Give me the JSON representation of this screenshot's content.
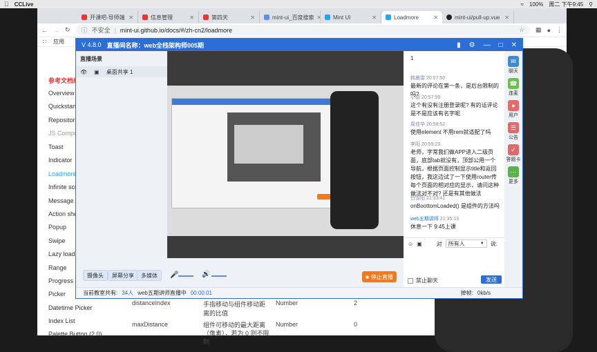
{
  "menubar": {
    "app": "CCLive",
    "battery": "100%",
    "clock": "周二 下午9:45"
  },
  "browser": {
    "tabs": [
      {
        "label": "开课吧-导师端"
      },
      {
        "label": "信息管理"
      },
      {
        "label": "第四天"
      },
      {
        "label": "mint-ui_百度搜索"
      },
      {
        "label": "Mint UI"
      },
      {
        "label": "Loadmore"
      },
      {
        "label": "mint-ui/pull-up.vue"
      }
    ],
    "security": "不安全",
    "url": "mint-ui.github.io/docs/#/zh-cn2/loadmore",
    "bookmarks_label": "应用"
  },
  "sidenav": {
    "heading": "参考文档编",
    "items": [
      "Overview",
      "Quickstart",
      "Repositories",
      "JS Components",
      "Toast",
      "Indicator",
      "Loadmore",
      "Infinite scroll",
      "Message box",
      "Action sheet",
      "Popup",
      "Swipe",
      "Lazy load",
      "Range",
      "Progress",
      "Picker",
      "Datetime Picker",
      "Index List",
      "Palette Button (2.0)"
    ]
  },
  "doc_table": {
    "rows": [
      {
        "name": "distanceIndex",
        "desc": "手指移动与组件移动距离的比值",
        "type": "Number",
        "default": "2"
      },
      {
        "name": "maxDistance",
        "desc": "组件可移动的最大距离（像素），若为 0 则不限制",
        "type": "Number",
        "default": "0"
      }
    ]
  },
  "live": {
    "version": "V 4.8.0",
    "room_label": "直播间名称：web全栈架构师005期",
    "scene_title": "直播场景",
    "scene_item": "桌面共享 1",
    "buttons": {
      "camera": "摄像头",
      "screen_share": "屏幕分享",
      "media": "多媒体",
      "stop": "停止直播"
    },
    "status": {
      "online_prefix": "当前教室共有:",
      "online_count": "34人",
      "host": "web五期讲师直播中",
      "timer": "00:00:01",
      "mute_all": "禁止聊天",
      "speed_label": "掉帧:",
      "speed": "0kb/s"
    },
    "chat": {
      "messages": [
        {
          "name": "",
          "time": "",
          "text": "1"
        },
        {
          "name": "韩晨雷",
          "time": "20:57:50",
          "text": "最新的评论在第一条，是后台限制的吗?"
        },
        {
          "name": "小德",
          "time": "20:57:59",
          "text": "这个有没有注册登录呢? 有的话评论是不是应该有名字呢"
        },
        {
          "name": "周佳华",
          "time": "20:58:52",
          "text": "使用element 不用rem就适配了吗"
        },
        {
          "name": "李阳",
          "time": "20:59:23",
          "text": "老师，字常我们做APP进入二级页面，底部tab就没有，顶部公用一个导航，根据页面控制显示title和返回按钮，我这边试了一下使用router传每个页面的相对应的显示，请问这种做法对不对? 还是有其他做法"
        },
        {
          "name": "白雪阳",
          "time": "21:33:41",
          "text": "onBoottomLoaded() 是组件的方法吗"
        },
        {
          "name": "web五期讲师",
          "time": "21:35:13",
          "text": "休息一下 9:45上课"
        }
      ],
      "target_label": "对",
      "target_value": "所有人",
      "say_label": "说:",
      "send": "发送"
    },
    "side": [
      {
        "label": "聊天",
        "icon": "chat-icon",
        "color": "#3c8ad9"
      },
      {
        "label": "连麦",
        "icon": "link-icon",
        "color": "#6cbf4e"
      },
      {
        "label": "用户",
        "icon": "user-icon",
        "color": "#e66a6a"
      },
      {
        "label": "公告",
        "icon": "notice-icon",
        "color": "#e06a6a"
      },
      {
        "label": "答题卡",
        "icon": "quiz-icon",
        "color": "#e06a6a"
      },
      {
        "label": "更多",
        "icon": "more-icon",
        "color": "#5bb14a"
      }
    ]
  }
}
